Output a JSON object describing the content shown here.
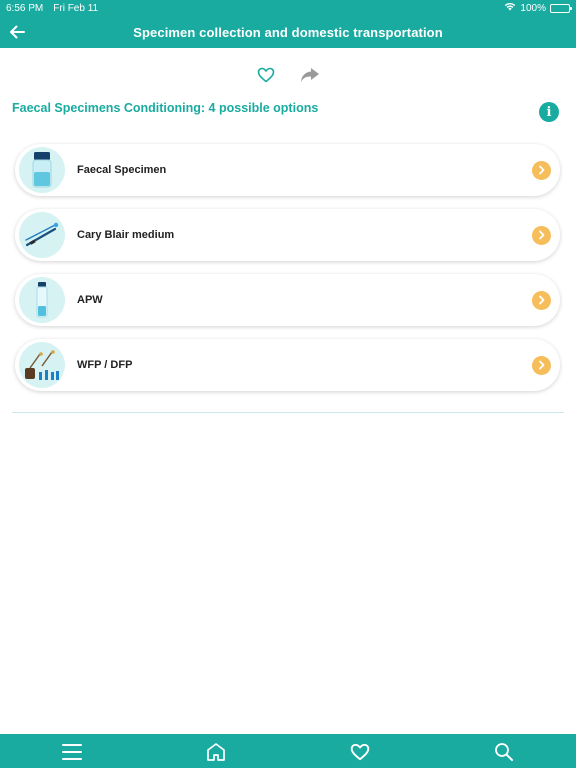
{
  "status": {
    "time": "6:56 PM",
    "date": "Fri Feb 11",
    "battery": "100%"
  },
  "header": {
    "title": "Specimen collection and domestic transportation"
  },
  "section": {
    "title": "Faecal Specimens Conditioning: 4 possible options",
    "info_glyph": "i"
  },
  "options": [
    {
      "label": "Faecal Specimen",
      "icon": "specimen-jar-icon"
    },
    {
      "label": "Cary Blair medium",
      "icon": "swab-icon"
    },
    {
      "label": "APW",
      "icon": "test-tube-icon"
    },
    {
      "label": "WFP / DFP",
      "icon": "filter-paper-icon"
    }
  ],
  "colors": {
    "primary": "#1aaba0",
    "accent": "#f6bd5b",
    "thumb_bg": "#d6f2f3"
  },
  "tab_bar": [
    "menu-icon",
    "home-icon",
    "favorites-icon",
    "search-icon"
  ]
}
